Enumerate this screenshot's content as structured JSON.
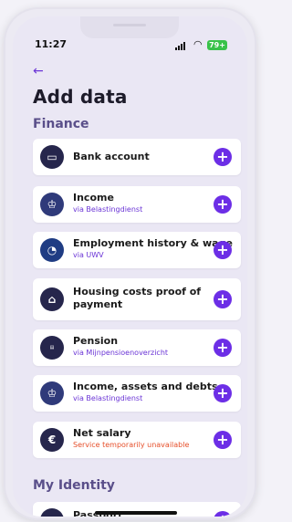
{
  "status_bar": {
    "time": "11:27",
    "battery": "79+"
  },
  "page": {
    "back_icon": "←",
    "title": "Add data"
  },
  "sections": {
    "finance": "Finance",
    "identity": "My Identity"
  },
  "finance_items": [
    {
      "label": "Bank account",
      "sub": "",
      "icon": "bank-card-icon"
    },
    {
      "label": "Income",
      "sub": "via Belastingdienst",
      "icon": "government-crest-icon"
    },
    {
      "label": "Employment history & wage",
      "sub": "via UWV",
      "icon": "uwv-logo-icon"
    },
    {
      "label": "Housing costs proof of payment",
      "sub": "",
      "icon": "house-icon"
    },
    {
      "label": "Pension",
      "sub": "via Mijnpensioenoverzicht",
      "icon": "pension-logo-icon"
    },
    {
      "label": "Income, assets and debts",
      "sub": "via Belastingdienst",
      "icon": "government-crest-icon"
    },
    {
      "label": "Net salary",
      "sub": "Service temporarily unavailable",
      "icon": "euro-icon"
    }
  ],
  "identity_items": [
    {
      "label": "Passport",
      "sub": ""
    }
  ],
  "colors": {
    "accent": "#6c2ee6",
    "error": "#e64f2a",
    "icon_bg": "#26264c"
  }
}
